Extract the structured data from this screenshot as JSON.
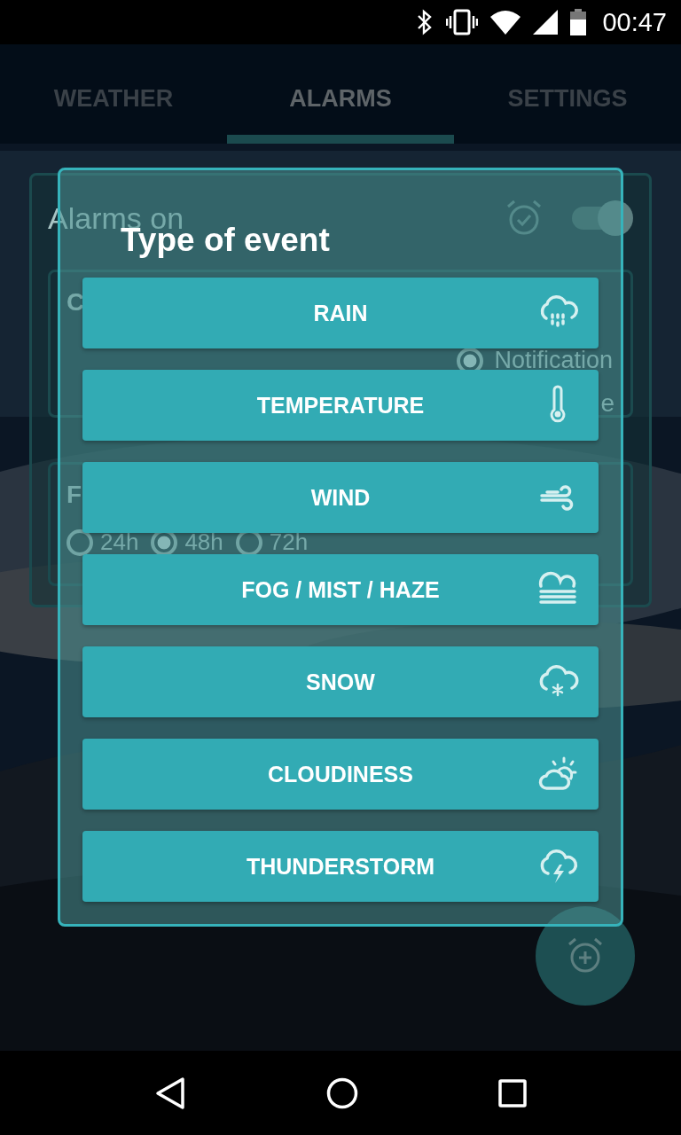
{
  "status_bar": {
    "time": "00:47"
  },
  "tabs": [
    {
      "label": "WEATHER",
      "selected": false
    },
    {
      "label": "ALARMS",
      "selected": true
    },
    {
      "label": "SETTINGS",
      "selected": false
    }
  ],
  "alarms_panel": {
    "title": "Alarms on",
    "switch_on": true,
    "alarm_card": {
      "title_fragment": "C",
      "notification": {
        "label": "Notification",
        "selected": true
      },
      "trailing_fragment": "e"
    },
    "forecast_card": {
      "title_fragment": "F",
      "options": [
        {
          "label": "24h",
          "selected": false
        },
        {
          "label": "48h",
          "selected": true
        },
        {
          "label": "72h",
          "selected": false
        }
      ]
    }
  },
  "dialog": {
    "title": "Type of event",
    "options": [
      {
        "label": "RAIN",
        "kind": "rain"
      },
      {
        "label": "TEMPERATURE",
        "kind": "temperature"
      },
      {
        "label": "WIND",
        "kind": "wind"
      },
      {
        "label": "FOG / MIST / HAZE",
        "kind": "fog"
      },
      {
        "label": "SNOW",
        "kind": "snow"
      },
      {
        "label": "CLOUDINESS",
        "kind": "cloudiness"
      },
      {
        "label": "THUNDERSTORM",
        "kind": "thunderstorm"
      }
    ]
  }
}
